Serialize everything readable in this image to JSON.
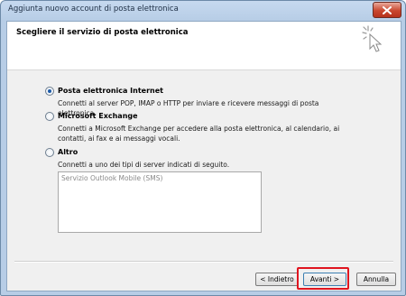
{
  "window": {
    "title": "Aggiunta nuovo account di posta elettronica"
  },
  "header": {
    "title": "Scegliere il servizio di posta elettronica"
  },
  "options": [
    {
      "label": "Posta elettronica Internet",
      "description": "Connetti al server POP, IMAP o HTTP per inviare e ricevere messaggi di posta elettronica.",
      "selected": true
    },
    {
      "label": "Microsoft Exchange",
      "description": "Connetti a Microsoft Exchange per accedere alla posta elettronica, al calendario, ai contatti, ai fax e ai messaggi vocali.",
      "selected": false
    },
    {
      "label": "Altro",
      "description": "Connetti a uno dei tipi di server indicati di seguito.",
      "selected": false
    }
  ],
  "server_list": {
    "items": [
      "Servizio Outlook Mobile (SMS)"
    ]
  },
  "buttons": {
    "back": "< Indietro",
    "next": "Avanti >",
    "cancel": "Annulla"
  },
  "colors": {
    "highlight": "#e0151f",
    "title_bar": "#b7cde6",
    "close_button": "#c9472f"
  }
}
